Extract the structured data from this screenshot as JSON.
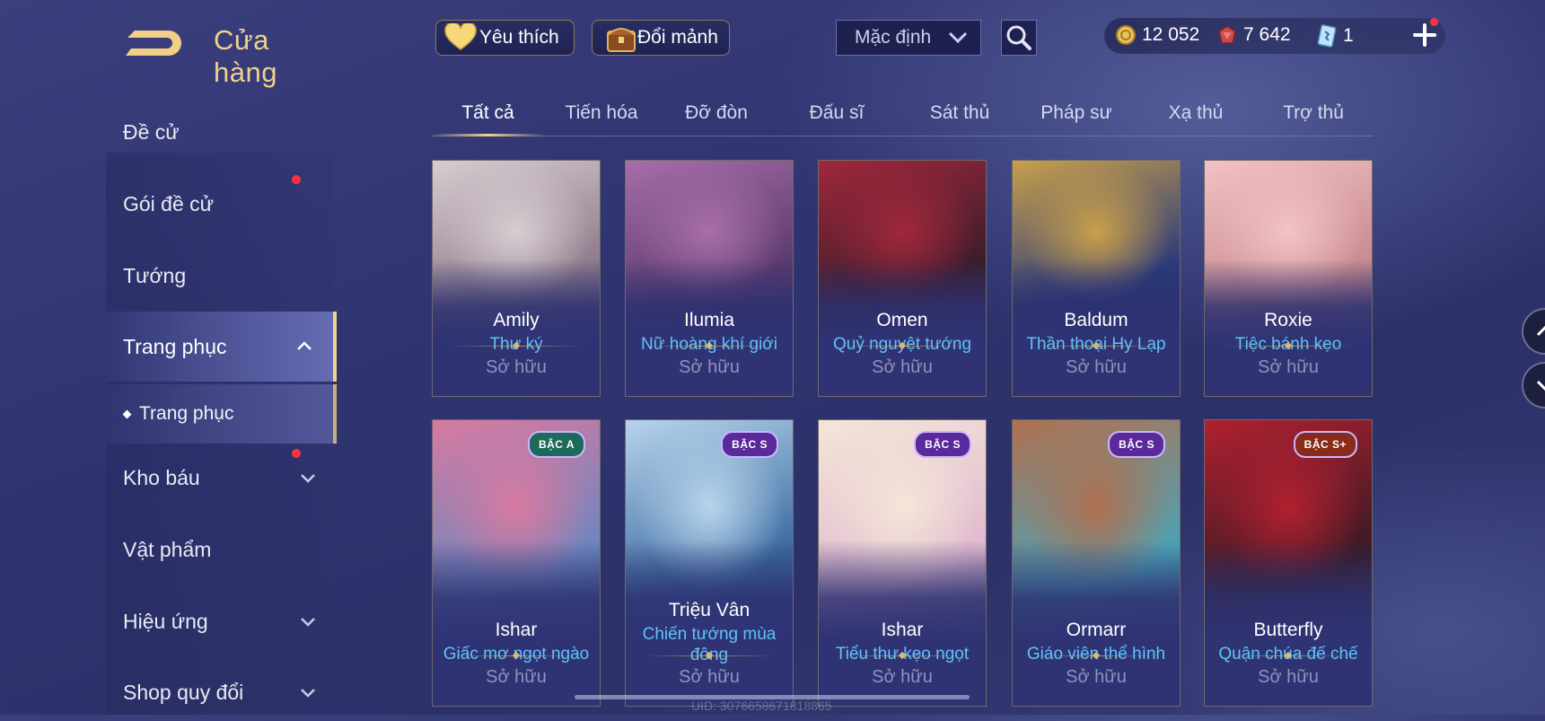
{
  "header": {
    "title": "Cửa hàng",
    "favorite_label": "Yêu thích",
    "exchange_label": "Đổi mảnh",
    "sort_value": "Mặc định"
  },
  "currency": {
    "gold": "12 052",
    "vouchers": "7 642",
    "tickets": "1"
  },
  "sidebar": {
    "items": [
      {
        "label": "Đề cử"
      },
      {
        "label": "Gói đề cử",
        "dot": true
      },
      {
        "label": "Tướng"
      },
      {
        "label": "Trang phục",
        "expanded": true
      },
      {
        "label": "Trang phục",
        "sub": true
      },
      {
        "label": "Kho báu",
        "dot": true
      },
      {
        "label": "Vật phẩm"
      },
      {
        "label": "Hiệu ứng"
      },
      {
        "label": "Shop quy đổi"
      }
    ]
  },
  "tabs": [
    "Tất cả",
    "Tiến hóa",
    "Đỡ đòn",
    "Đấu sĩ",
    "Sát thủ",
    "Pháp sư",
    "Xạ thủ",
    "Trợ thủ"
  ],
  "active_tab": "Tất cả",
  "cards": [
    {
      "hero": "Amily",
      "skin": "Thư ký",
      "status": "Sở hữu",
      "colors": [
        "#8e7a8a",
        "#d8cdd2"
      ]
    },
    {
      "hero": "Ilumia",
      "skin": "Nữ hoàng khí giới",
      "status": "Sở hữu",
      "colors": [
        "#5a3a6e",
        "#a86ea8"
      ]
    },
    {
      "hero": "Omen",
      "skin": "Quỷ nguyệt tướng",
      "status": "Sở hữu",
      "colors": [
        "#3a1c2c",
        "#a0283a"
      ]
    },
    {
      "hero": "Baldum",
      "skin": "Thần thoại Hy Lạp",
      "status": "Sở hữu",
      "colors": [
        "#2a3a7a",
        "#c9a04a"
      ]
    },
    {
      "hero": "Roxie",
      "skin": "Tiệc bánh kẹo",
      "status": "Sở hữu",
      "colors": [
        "#c88a8e",
        "#f2c2c4"
      ]
    },
    {
      "hero": "Ishar",
      "skin": "Giấc mơ ngọt ngào",
      "status": "Sở hữu",
      "tier": "BẬC A",
      "tier_color": "#1e6a5a",
      "colors": [
        "#6a86c0",
        "#d87aa0"
      ]
    },
    {
      "hero": "Triệu Vân",
      "skin": "Chiến tướng mùa đông",
      "status": "Sở hữu",
      "tier": "BẬC S",
      "tier_color": "#5a2a9a",
      "colors": [
        "#3a6aa0",
        "#b8d4ec"
      ]
    },
    {
      "hero": "Ishar",
      "skin": "Tiểu thư kẹo ngọt",
      "status": "Sở hữu",
      "tier": "BẬC S",
      "tier_color": "#5a2a9a",
      "colors": [
        "#e0b8d0",
        "#f4e6d8"
      ]
    },
    {
      "hero": "Ormarr",
      "skin": "Giáo viên thể hình",
      "status": "Sở hữu",
      "tier": "BẬC S",
      "tier_color": "#5a2a9a",
      "colors": [
        "#4aa4b8",
        "#b07050"
      ]
    },
    {
      "hero": "Butterfly",
      "skin": "Quận chúa đế chế",
      "status": "Sở hữu",
      "tier": "BẬC S+",
      "tier_color": "#8a2a1a",
      "colors": [
        "#3a1a24",
        "#b02030"
      ]
    }
  ],
  "footer": {
    "uid": "UID: 3076658671818865"
  },
  "colors": {
    "accent_gold": "#f2d28c",
    "skin_blue": "#5fc3f5",
    "notify_red": "#ff3040"
  }
}
